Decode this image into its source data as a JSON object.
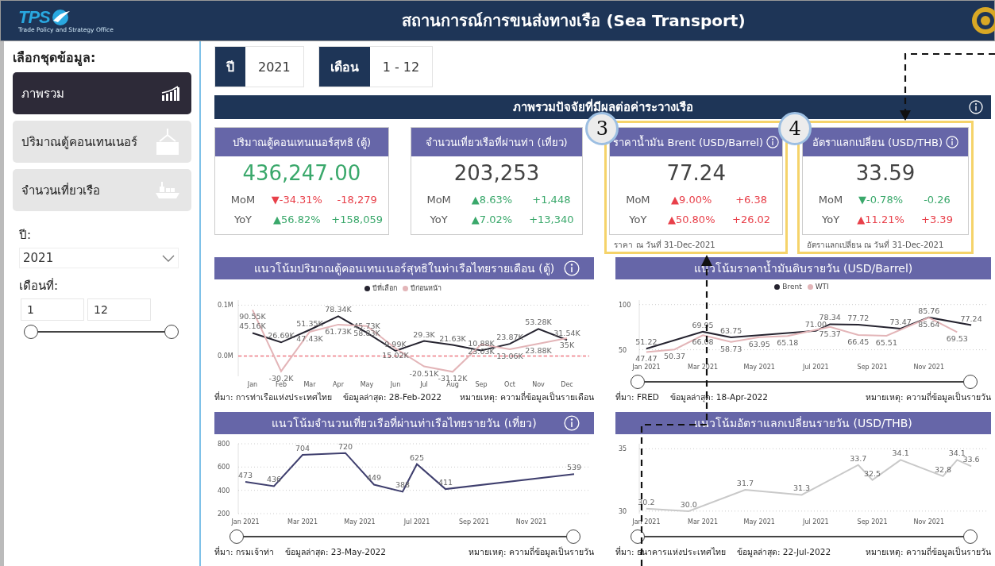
{
  "header": {
    "logo_text": "TPS",
    "logo_subtitle": "Trade Policy and Strategy Office",
    "title": "สถานการณ์การขนส่งทางเรือ (Sea Transport)"
  },
  "sidebar": {
    "heading": "เลือกชุดข้อมูล:",
    "items": [
      {
        "label": "ภาพรวม",
        "selected": true,
        "kind": "chart"
      },
      {
        "label": "ปริมาณตู้คอนเทนเนอร์",
        "selected": false,
        "kind": "container"
      },
      {
        "label": "จำนวนเที่ยวเรือ",
        "selected": false,
        "kind": "ship"
      }
    ],
    "year_label": "ปี:",
    "year_value": "2021",
    "month_label": "เดือนที่:",
    "month_from": "1",
    "month_to": "12",
    "month_slider": [
      {
        "level": 0
      },
      {
        "level": 1
      }
    ]
  },
  "filters": [
    {
      "label": "ปี",
      "value": "2021"
    },
    {
      "label": "เดือน",
      "value": "1 - 12"
    }
  ],
  "overview_title": "ภาพรวมปัจจัยที่มีผลต่อค่าระวางเรือ",
  "kpis": [
    {
      "title": "ปริมาณตู้คอนเทนเนอร์สุทธิ (ตู้)",
      "value": "436,247.00",
      "color": "#3aa86b",
      "rows": [
        {
          "label": "MoM",
          "percent": "▼-34.31%",
          "change": "-18,279",
          "color": "#e8404a"
        },
        {
          "label": "YoY",
          "percent": "▲56.82%",
          "change": "+158,059",
          "color": "#3aa86b"
        }
      ]
    },
    {
      "title": "จำนวนเที่ยวเรือที่ผ่านท่า (เที่ยว)",
      "value": "203,253",
      "color": "#444444",
      "rows": [
        {
          "label": "MoM",
          "percent": "▲8.63%",
          "change": "+1,448",
          "color": "#3aa86b"
        },
        {
          "label": "YoY",
          "percent": "▲7.02%",
          "change": "+13,340",
          "color": "#3aa86b"
        }
      ]
    },
    {
      "title": "ราคาน้ำมัน Brent (USD/Barrel)",
      "value": "77.24",
      "color": "#444444",
      "info": true,
      "highlighted": true,
      "badge": "3",
      "footnote": "ราคา ณ วันที่ 31-Dec-2021",
      "rows": [
        {
          "label": "MoM",
          "percent": "▲9.00%",
          "change": "+6.38",
          "color": "#e8404a"
        },
        {
          "label": "YoY",
          "percent": "▲50.80%",
          "change": "+26.02",
          "color": "#e8404a"
        }
      ]
    },
    {
      "title": "อัตราแลกเปลี่ยน (USD/THB)",
      "value": "33.59",
      "color": "#444444",
      "info": true,
      "highlighted": true,
      "badge": "4",
      "footnote": "อัตราแลกเปลี่ยน ณ วันที่ 31-Dec-2021",
      "rows": [
        {
          "label": "MoM",
          "percent": "▼-0.78%",
          "change": "-0.26",
          "color": "#3aa86b"
        },
        {
          "label": "YoY",
          "percent": "▲11.21%",
          "change": "+3.39",
          "color": "#e8404a"
        }
      ]
    }
  ],
  "charts": [
    {
      "title": "แนวโน้มปริมาณตู้คอนเทนเนอร์สุทธิในท่าเรือไทยรายเดือน (ตู้)",
      "info": true,
      "source": "ที่มา: การท่าเรือแห่งประเทศไทย",
      "updated": "ข้อมูลล่าสุด: 28-Feb-2022",
      "note": "หมายเหตุ: ความถี่ข้อมูลเป็นรายเดือน",
      "chart_data": {
        "type": "line",
        "legend": "top",
        "categories": [
          "Jan",
          "Feb",
          "Mar",
          "Apr",
          "May",
          "Jun",
          "Jul",
          "Aug",
          "Sep",
          "Oct",
          "Nov",
          "Dec"
        ],
        "ylim": [
          -40000,
          110000
        ],
        "yticks": [
          {
            "value": 0,
            "label": "0.0M"
          },
          {
            "value": 100000,
            "label": "0.1M"
          }
        ],
        "data_labels": true,
        "ref_lines": [
          {
            "axis": "y",
            "value": 0,
            "color": "#f07b85"
          }
        ],
        "series": [
          {
            "name": "ปีที่เลือก",
            "color": "#25232f",
            "values": [
              45160,
              26690,
              51350,
              78340,
              45730,
              9990,
              29300,
              21630,
              10880,
              23870,
              53280,
              31540
            ],
            "value_labels": [
              "45.16K",
              "26.69K",
              "51.35K",
              "78.34K",
              "45.73K",
              "9.99K",
              "29.3K",
              "21.63K",
              "10.88K",
              "23.87K",
              "53.28K",
              "31.54K"
            ]
          },
          {
            "name": "ปีก่อนหน้า",
            "color": "#e3b5b8",
            "values": [
              90550,
              -30200,
              47430,
              61730,
              58830,
              15020,
              -20510,
              -31120,
              23030,
              13060,
              23880,
              35000
            ],
            "value_labels": [
              "90.55K",
              "-30.2K",
              "47.43K",
              "61.73K",
              "58.83K",
              "15.02K",
              "-20.51K",
              "-31.12K",
              "23.03K",
              "13.06K",
              "23.88K",
              "35K"
            ]
          }
        ]
      }
    },
    {
      "title": "แนวโน้มราคาน้ำมันดิบรายวัน (USD/Barrel)",
      "range_slider": [
        {
          "level": 0
        },
        {
          "level": 1
        }
      ],
      "source": "ที่มา: FRED",
      "updated": "ข้อมูลล่าสุด: 18-Apr-2022",
      "note": "หมายเหตุ: ความถี่ข้อมูลเป็นรายวัน",
      "chart_data": {
        "type": "line",
        "legend": "top",
        "categories": [
          "Jan 2021",
          null,
          null,
          null,
          "Mar 2021",
          null,
          null,
          null,
          "May 2021",
          null,
          null,
          null,
          "Jul 2021",
          null,
          null,
          null,
          "Sep 2021",
          null,
          null,
          null,
          "Nov 2021",
          null,
          null,
          null
        ],
        "ylim": [
          40,
          105
        ],
        "yticks": [
          50,
          100
        ],
        "data_labels": true,
        "series": [
          {
            "name": "Brent",
            "color": "#25232f",
            "values": [
              51.22,
              null,
              null,
              null,
              69.95,
              null,
              63.75,
              null,
              null,
              null,
              null,
              null,
              71.0,
              78.34,
              null,
              77.72,
              null,
              null,
              73.47,
              null,
              85.76,
              null,
              null,
              77.24
            ],
            "value_labels": [
              "51.22",
              null,
              null,
              null,
              "69.95",
              null,
              "63.75",
              null,
              null,
              null,
              null,
              null,
              "71.00",
              "78.34",
              null,
              "77.72",
              null,
              null,
              "73.47",
              null,
              "85.76",
              null,
              null,
              "77.24"
            ]
          },
          {
            "name": "WTI",
            "color": "#e3b5b8",
            "values": [
              47.47,
              null,
              50.37,
              null,
              66.08,
              null,
              58.73,
              null,
              63.95,
              null,
              65.18,
              null,
              null,
              75.37,
              null,
              66.45,
              null,
              65.51,
              null,
              null,
              85.64,
              null,
              69.53,
              null
            ],
            "value_labels": [
              "47.47",
              null,
              "50.37",
              null,
              "66.08",
              null,
              "58.73",
              null,
              "63.95",
              null,
              "65.18",
              null,
              null,
              "75.37",
              null,
              "66.45",
              null,
              "65.51",
              null,
              null,
              "85.64",
              null,
              "69.53",
              null
            ]
          }
        ]
      }
    },
    {
      "title": "แนวโน้มจำนวนเที่ยวเรือที่ผ่านท่าเรือไทยรายวัน (เที่ยว)",
      "info": true,
      "range_slider": [
        {
          "level": 0
        },
        {
          "level": 1
        }
      ],
      "source": "ที่มา: กรมเจ้าท่า",
      "updated": "ข้อมูลล่าสุด: 23-May-2022",
      "note": "หมายเหตุ: ความถี่ข้อมูลเป็นรายวัน",
      "chart_data": {
        "type": "line",
        "categories": [
          "Jan 2021",
          null,
          null,
          null,
          "Mar 2021",
          null,
          null,
          null,
          "May 2021",
          null,
          null,
          null,
          "Jul 2021",
          null,
          null,
          null,
          "Sep 2021",
          null,
          null,
          null,
          "Nov 2021",
          null,
          null,
          null
        ],
        "ylim": [
          200,
          800
        ],
        "yticks": [
          200,
          400,
          600,
          800
        ],
        "data_labels": true,
        "series": [
          {
            "color": "#3f3f6e",
            "values": [
              473,
              null,
              436,
              null,
              704,
              null,
              null,
              720,
              null,
              449,
              null,
              388,
              625,
              null,
              411,
              null,
              null,
              null,
              null,
              null,
              null,
              null,
              null,
              539
            ],
            "value_labels": [
              "473",
              null,
              "436",
              null,
              "704",
              null,
              null,
              "720",
              null,
              "449",
              null,
              "388",
              "625",
              null,
              "411",
              null,
              null,
              null,
              null,
              null,
              null,
              null,
              null,
              "539"
            ]
          }
        ]
      }
    },
    {
      "title": "แนวโน้มอัตราแลกเปลี่ยนรายวัน (USD/THB)",
      "range_slider": [
        {
          "level": 0
        },
        {
          "level": 1
        }
      ],
      "source": "ที่มา: ธนาคารแห่งประเทศไทย",
      "updated": "ข้อมูลล่าสุด: 22-Jul-2022",
      "note": "หมายเหตุ: ความถี่ข้อมูลเป็นรายวัน",
      "chart_data": {
        "type": "line",
        "categories": [
          "Jan 2021",
          null,
          null,
          null,
          "Mar 2021",
          null,
          null,
          null,
          "May 2021",
          null,
          null,
          null,
          "Jul 2021",
          null,
          null,
          null,
          "Sep 2021",
          null,
          null,
          null,
          "Nov 2021",
          null,
          null,
          null
        ],
        "ylim": [
          29.8,
          35.4
        ],
        "yticks": [
          30,
          35
        ],
        "data_labels": true,
        "series": [
          {
            "color": "#c9c9c9",
            "values": [
              30.2,
              null,
              null,
              30.0,
              null,
              null,
              null,
              31.7,
              null,
              null,
              null,
              31.3,
              null,
              null,
              null,
              33.7,
              32.5,
              null,
              34.1,
              null,
              null,
              32.8,
              34.1,
              33.6
            ],
            "value_labels": [
              "30.2",
              null,
              null,
              "30.0",
              null,
              null,
              null,
              "31.7",
              null,
              null,
              null,
              "31.3",
              null,
              null,
              null,
              "33.7",
              "32.5",
              null,
              "34.1",
              null,
              null,
              "32.8",
              "34.1",
              "33.6"
            ]
          }
        ]
      }
    }
  ]
}
